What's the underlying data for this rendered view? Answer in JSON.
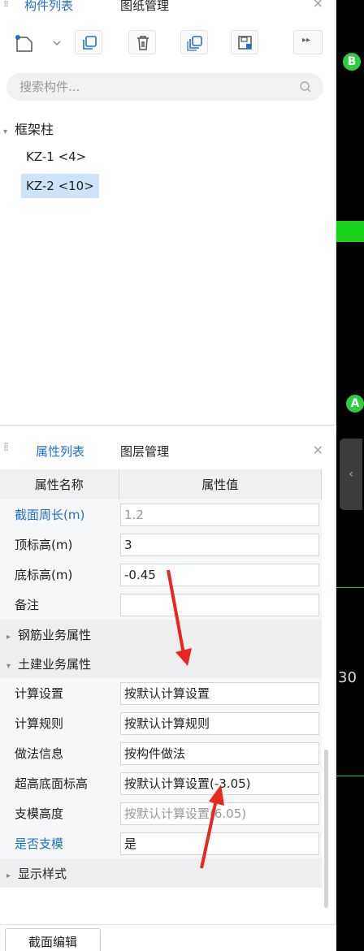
{
  "component_panel": {
    "tabs": [
      {
        "label": "构件列表"
      },
      {
        "label": "图纸管理"
      }
    ],
    "close": "×",
    "toolbar_more": "▸▸",
    "search_placeholder": "搜索构件...",
    "tree": {
      "group_label": "框架柱",
      "items": [
        {
          "label": "KZ-1 <4>",
          "selected": false
        },
        {
          "label": "KZ-2 <10>",
          "selected": true
        }
      ]
    }
  },
  "property_panel": {
    "tabs": [
      {
        "label": "属性列表"
      },
      {
        "label": "图层管理"
      }
    ],
    "close": "×",
    "headers": {
      "name": "属性名称",
      "value": "属性值"
    },
    "rows": [
      {
        "name": "截面周长(m)",
        "value": "1.2"
      },
      {
        "name": "顶标高(m)",
        "value": "3"
      },
      {
        "name": "底标高(m)",
        "value": "-0.45"
      },
      {
        "name": "备注",
        "value": ""
      }
    ],
    "group_rebar": "钢筋业务属性",
    "group_civil": "土建业务属性",
    "civil_rows": [
      {
        "name": "计算设置",
        "value": "按默认计算设置"
      },
      {
        "name": "计算规则",
        "value": "按默认计算规则"
      },
      {
        "name": "做法信息",
        "value": "按构件做法"
      },
      {
        "name": "超高底面标高",
        "value": "按默认计算设置(-3.05)"
      },
      {
        "name": "支模高度",
        "value": "按默认计算设置(6.05)"
      },
      {
        "name": "是否支模",
        "value": "是"
      }
    ],
    "group_display": "显示样式"
  },
  "bottom": {
    "section_edit": "截面编辑"
  },
  "canvas": {
    "axis_b": "B",
    "axis_a": "A",
    "dimension_text": "30"
  },
  "colors": {
    "accent": "#1f6fd1",
    "selected_bg": "#cfe3f7",
    "axis_green": "#2ecc40",
    "annotation_red": "#e8271e"
  }
}
